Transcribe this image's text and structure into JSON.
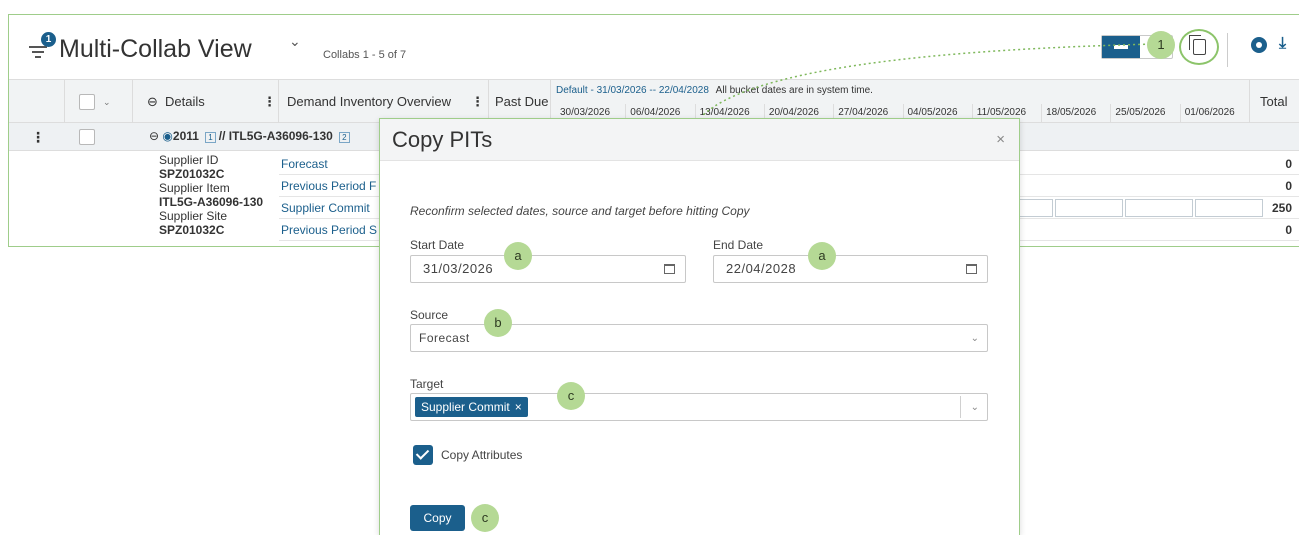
{
  "app": {
    "title": "Multi-Collab View",
    "collab_count": "Collabs 1 - 5 of 7",
    "filter_badge": "1"
  },
  "table": {
    "header": {
      "details": "Details",
      "demand_overview": "Demand Inventory Overview",
      "past_due": "Past Due",
      "total": "Total",
      "bucket_range_link": "Default - 31/03/2026 -- 22/04/2028",
      "bucket_note": "All bucket dates are in system time.",
      "bucket_dates": [
        "30/03/2026",
        "06/04/2026",
        "13/04/2026",
        "20/04/2026",
        "27/04/2026",
        "04/05/2026",
        "11/05/2026",
        "18/05/2026",
        "25/05/2026",
        "01/06/2026"
      ]
    },
    "group_row": {
      "label": "2011",
      "badge1": "1",
      "item": "// ITL5G-A36096-130",
      "badge2": "2"
    },
    "details": {
      "supplier_id_label": "Supplier ID",
      "supplier_id": "SPZ01032C",
      "supplier_item_label": "Supplier Item",
      "supplier_item": "ITL5G-A36096-130",
      "supplier_site_label": "Supplier Site",
      "supplier_site": "SPZ01032C"
    },
    "rows": [
      {
        "label": "Forecast",
        "total": "0"
      },
      {
        "label": "Previous Period F",
        "total": "0"
      },
      {
        "label": "Supplier Commit",
        "total": "250"
      },
      {
        "label": "Previous Period S",
        "total": "0"
      }
    ]
  },
  "modal": {
    "title": "Copy PITs",
    "close": "×",
    "instruction": "Reconfirm selected dates, source and target before hitting Copy",
    "start_label": "Start Date",
    "start_value": "31/03/2026",
    "end_label": "End Date",
    "end_value": "22/04/2028",
    "source_label": "Source",
    "source_value": "Forecast",
    "target_label": "Target",
    "target_tag": "Supplier Commit",
    "tag_remove": "×",
    "copy_attributes_label": "Copy Attributes",
    "copy_button": "Copy"
  },
  "markers": {
    "m1": "1",
    "start": "a",
    "end": "a",
    "source": "b",
    "target": "c",
    "copy": "c"
  },
  "colors": {
    "accent": "#1b5f8c",
    "marker": "#b5d995",
    "frame": "#9fcd8a"
  }
}
